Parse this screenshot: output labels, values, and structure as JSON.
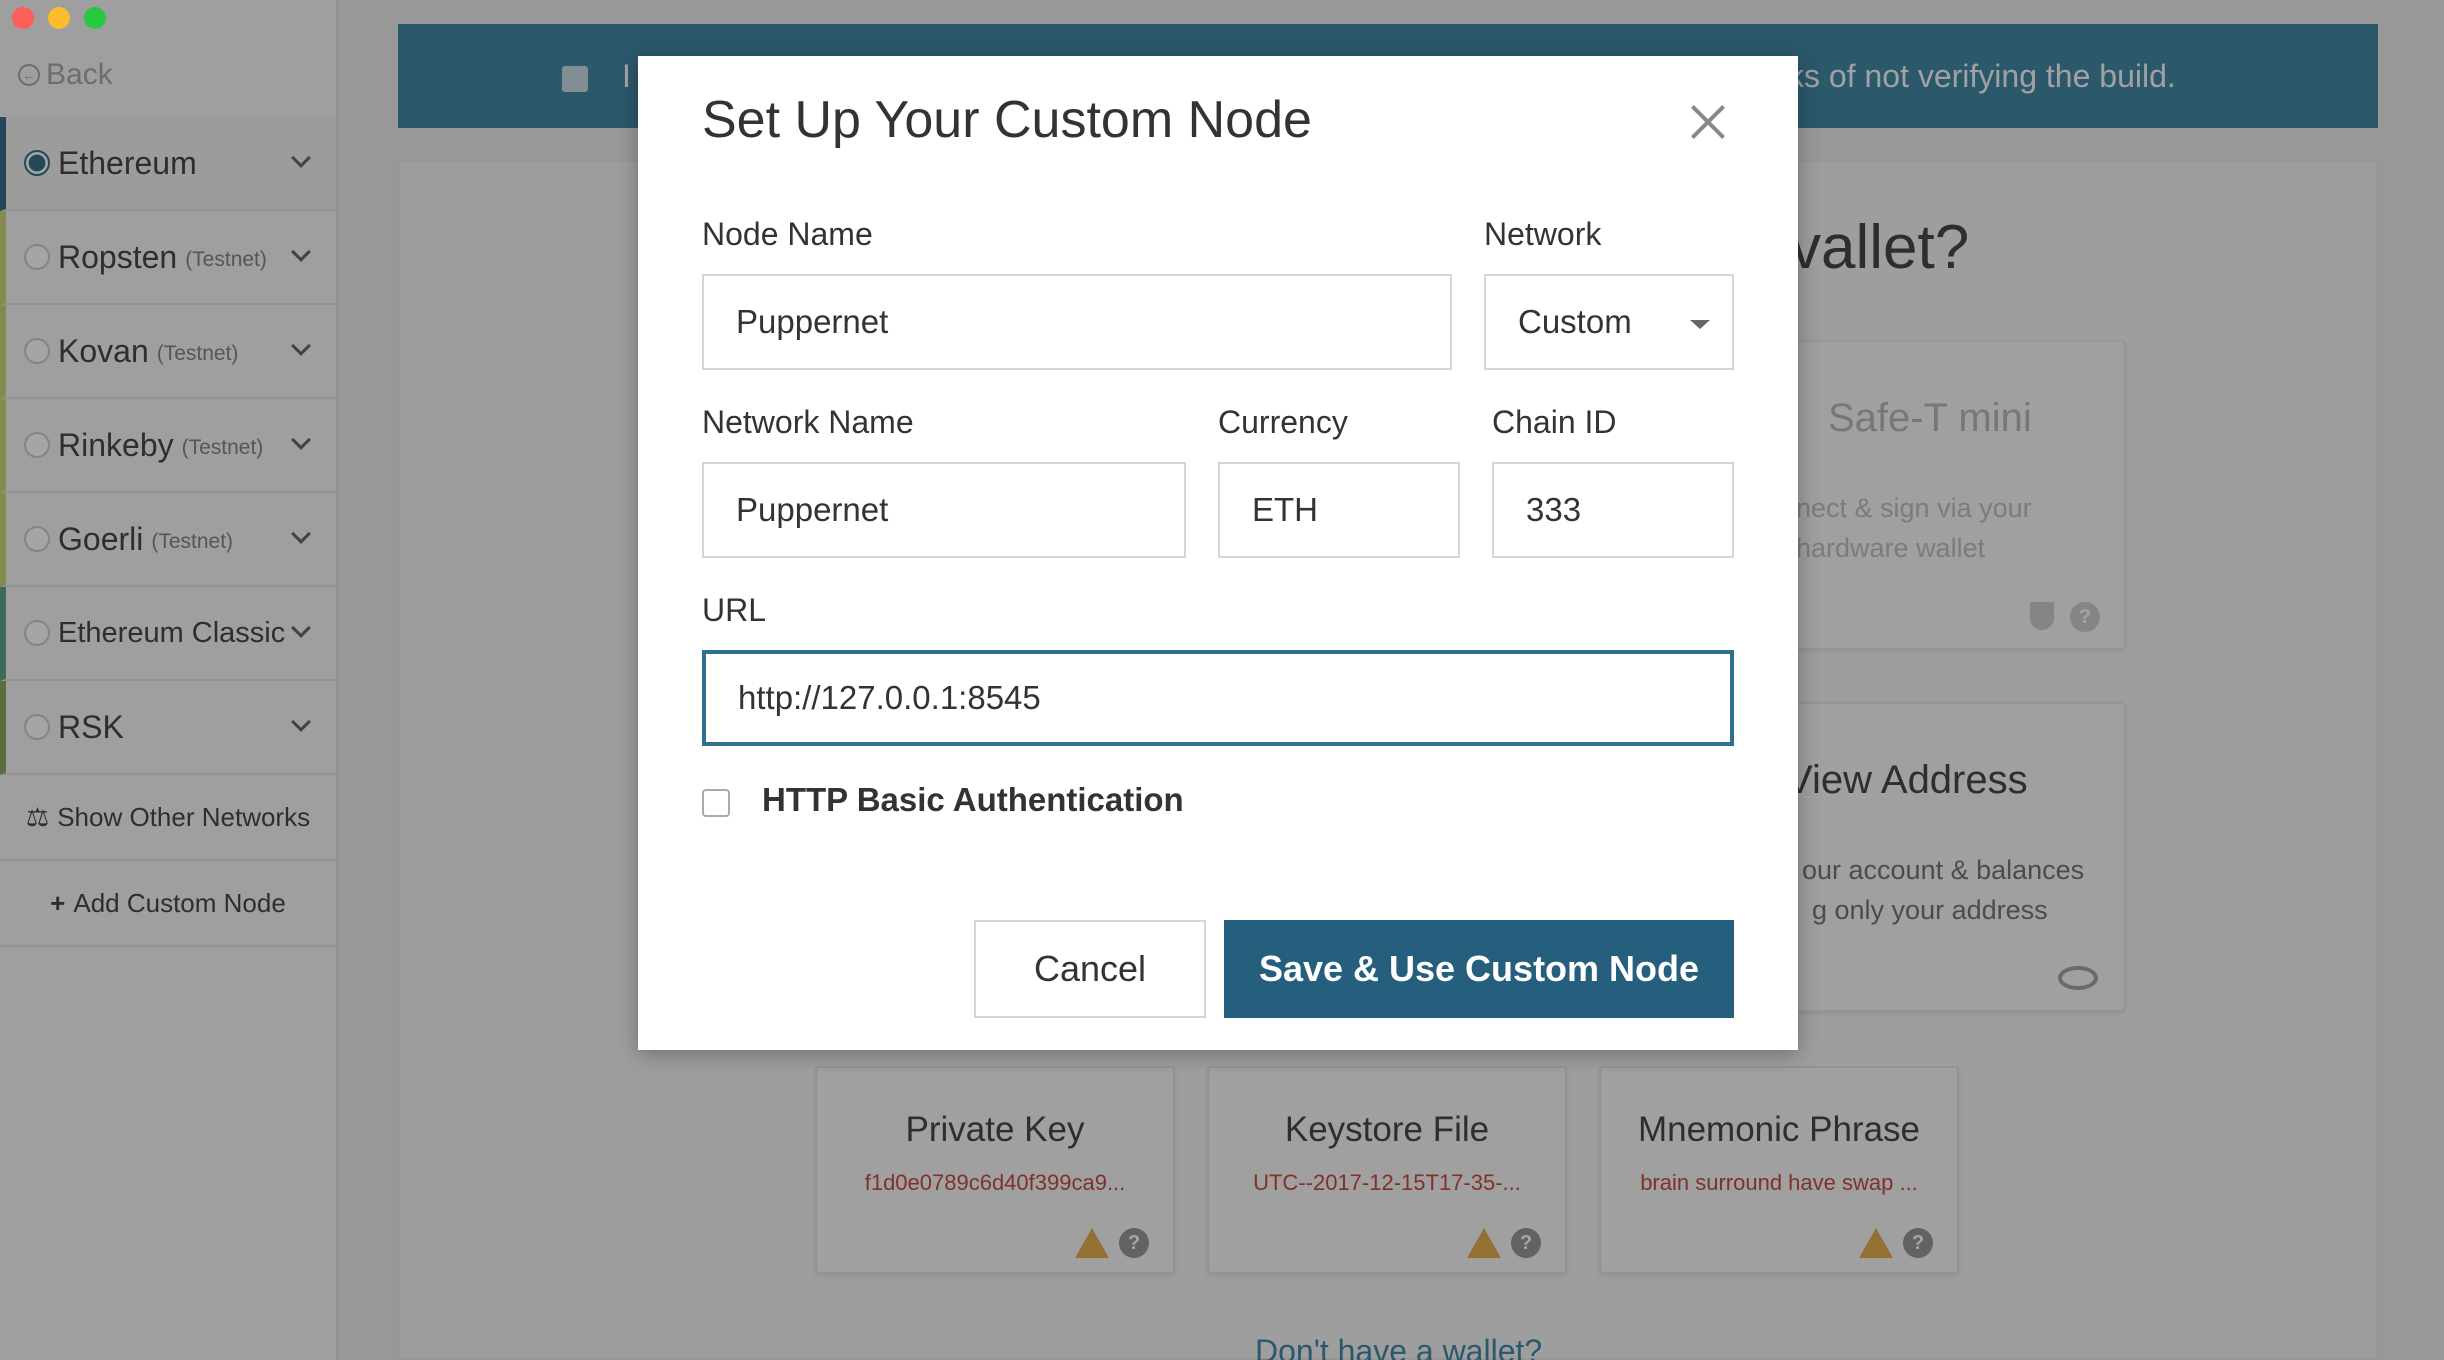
{
  "sidebar": {
    "back_label": "Back",
    "networks": [
      {
        "name": "Ethereum",
        "sub": "",
        "selected": true
      },
      {
        "name": "Ropsten",
        "sub": "(Testnet)",
        "selected": false
      },
      {
        "name": "Kovan",
        "sub": "(Testnet)",
        "selected": false
      },
      {
        "name": "Rinkeby",
        "sub": "(Testnet)",
        "selected": false
      },
      {
        "name": "Goerli",
        "sub": "(Testnet)",
        "selected": false
      },
      {
        "name": "Ethereum Classic",
        "sub": "",
        "selected": false
      },
      {
        "name": "RSK",
        "sub": "",
        "selected": false
      }
    ],
    "show_other": "Show Other Networks",
    "add_custom": "Add Custom Node"
  },
  "background": {
    "banner_text": "ks of not verifying the build.",
    "banner_prefix": "I",
    "question_title": "vallet?",
    "safet": {
      "title": "Safe-T mini",
      "desc1": "nect & sign via your",
      "desc2": "hardware wallet"
    },
    "view_address": {
      "title": "View Address",
      "desc1": "our account & balances",
      "desc2": "g only your address"
    },
    "tiles": [
      {
        "title": "Private Key",
        "value": "f1d0e0789c6d40f399ca9..."
      },
      {
        "title": "Keystore File",
        "value": "UTC--2017-12-15T17-35-..."
      },
      {
        "title": "Mnemonic Phrase",
        "value": "brain surround have swap ..."
      }
    ],
    "dont_have": "Don't have a wallet?"
  },
  "modal": {
    "title": "Set Up Your Custom Node",
    "node_name_label": "Node Name",
    "node_name_value": "Puppernet",
    "network_label": "Network",
    "network_value": "Custom",
    "network_name_label": "Network Name",
    "network_name_value": "Puppernet",
    "currency_label": "Currency",
    "currency_value": "ETH",
    "chain_id_label": "Chain ID",
    "chain_id_value": "333",
    "url_label": "URL",
    "url_value": "http://127.0.0.1:8545",
    "auth_label": "HTTP Basic Authentication",
    "cancel_label": "Cancel",
    "save_label": "Save & Use Custom Node"
  },
  "colors": {
    "accent": "#265f7d",
    "banner": "#2f7b9e",
    "warning": "#e0a53a",
    "error_text": "#c0392b"
  }
}
